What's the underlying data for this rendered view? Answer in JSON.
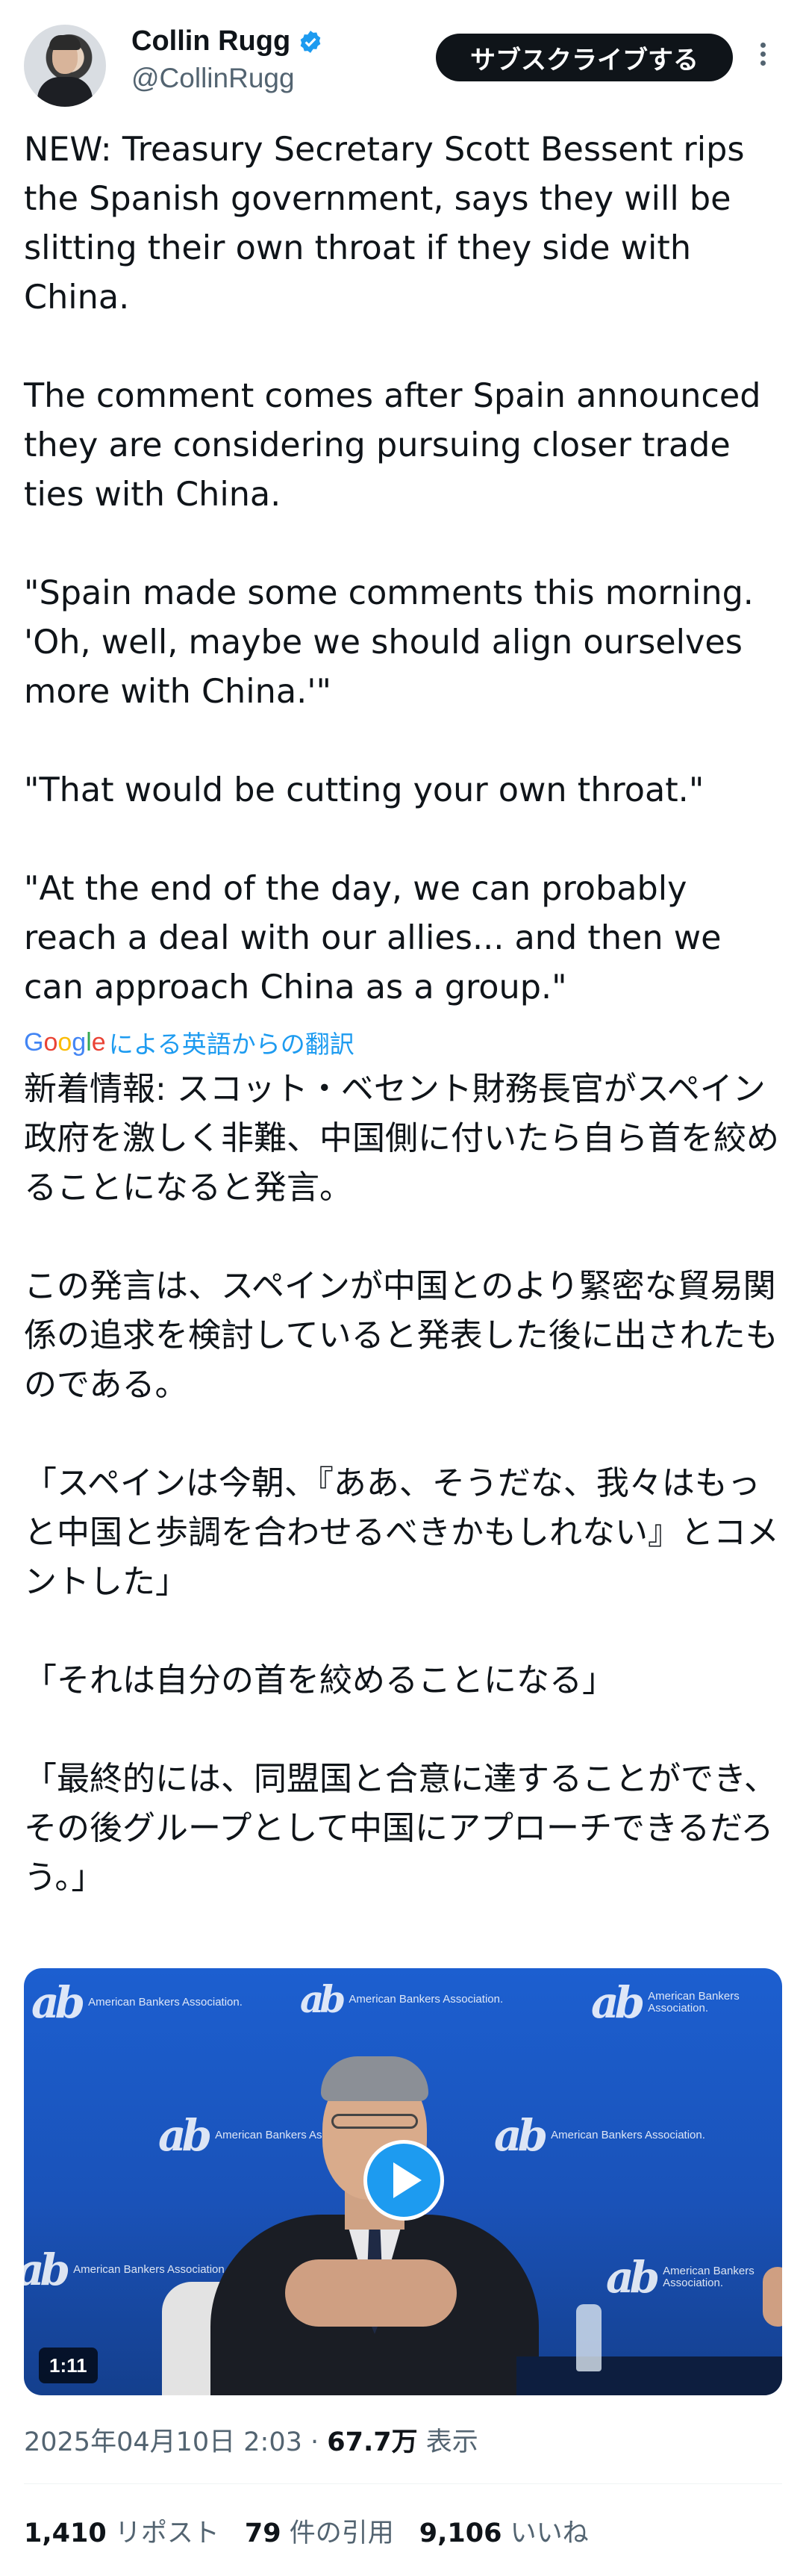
{
  "author": {
    "display_name": "Collin Rugg",
    "handle": "@CollinRugg",
    "verified_icon": "verified-badge-icon",
    "verified_color": "#1d9bf0"
  },
  "header": {
    "subscribe_label": "サブスクライブする",
    "more_icon": "more-vertical-icon"
  },
  "tweet": {
    "text": "NEW: Treasury Secretary Scott Bessent rips the Spanish government, says they will be slitting their own throat if they side with China.\n\nThe comment comes after Spain announced they are considering pursuing closer trade ties with China.\n\n\"Spain made some comments this morning. 'Oh, well, maybe we should align ourselves more with China.'\"\n\n\"That would be cutting your own throat.\"\n\n\"At the end of the day, we can probably reach a deal with our allies... and then we can approach China as a group.\"",
    "translation_label": "による英語からの翻訳",
    "google_logo": "Google",
    "translated_text": "新着情報: スコット・ベセント財務長官がスペイン政府を激しく非難、中国側に付いたら自ら首を絞めることになると発言。\n\nこの発言は、スペインが中国とのより緊密な貿易関係の追求を検討していると発表した後に出されたものである。\n\n「スペインは今朝、『ああ、そうだな、我々はもっと中国と歩調を合わせるべきかもしれない』とコメントした」\n\n「それは自分の首を絞めることになる」\n\n「最終的には、同盟国と合意に達することができ、その後グループとして中国にアプローチできるだろう。」"
  },
  "video": {
    "duration": "1:11",
    "play_icon": "play-icon",
    "logo_text": "American Bankers Association."
  },
  "meta": {
    "timestamp": "2025年04月10日 2:03",
    "separator": "·",
    "views_count": "67.7万",
    "views_label": "表示"
  },
  "stats": {
    "reposts_count": "1,410",
    "reposts_label": "リポスト",
    "quotes_count": "79",
    "quotes_label": "件の引用",
    "likes_count": "9,106",
    "likes_label": "いいね"
  },
  "colors": {
    "accent": "#1d9bf0",
    "text": "#0f1419",
    "secondary": "#536471"
  }
}
